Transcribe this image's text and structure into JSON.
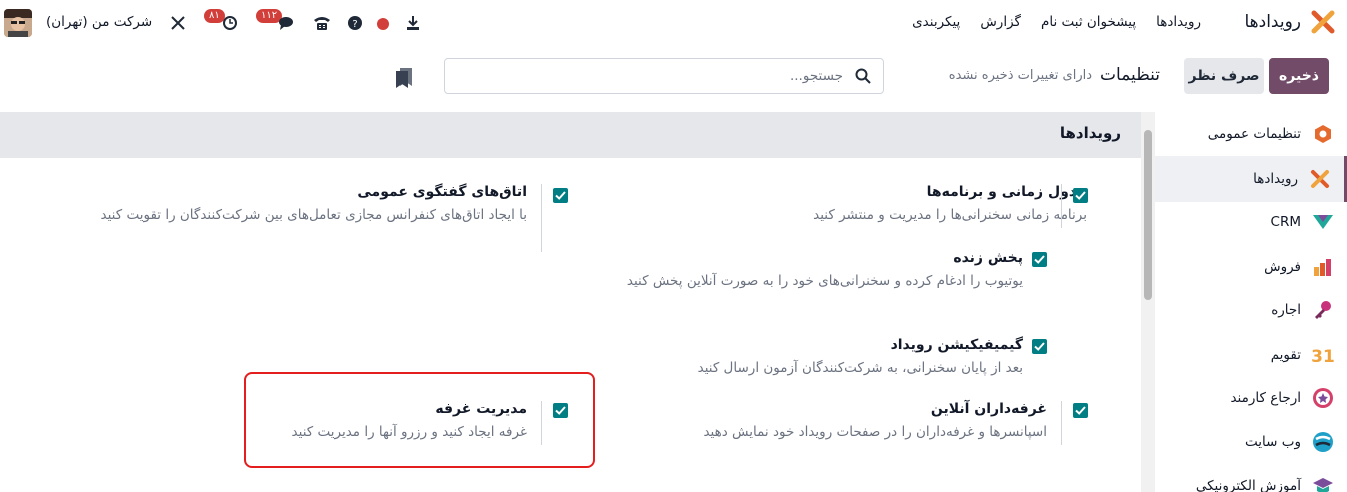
{
  "navbar": {
    "app_name": "رویدادها",
    "menu": [
      "رویدادها",
      "پیشخوان ثبت نام",
      "گزارش",
      "پیکربندی"
    ],
    "company": "شرکت من (تهران)",
    "activity_badge": "۸۱",
    "messages_badge": "۱۱۲"
  },
  "control_panel": {
    "save_label": "ذخیره",
    "discard_label": "صرف نظر",
    "title": "تنظیمات",
    "unsaved": "دارای تغییرات ذخیره نشده",
    "search_placeholder": "جستجو..."
  },
  "sidebar": {
    "items": [
      {
        "label": "تنظیمات عمومی",
        "icon": "settings-icon"
      },
      {
        "label": "رویدادها",
        "icon": "events-icon"
      },
      {
        "label": "CRM",
        "icon": "crm-icon"
      },
      {
        "label": "فروش",
        "icon": "sales-icon"
      },
      {
        "label": "اجاره",
        "icon": "rental-icon"
      },
      {
        "label": "تقویم",
        "icon": "calendar-icon"
      },
      {
        "label": "ارجاع کارمند",
        "icon": "referral-icon"
      },
      {
        "label": "وب سایت",
        "icon": "website-icon"
      },
      {
        "label": "آموزش الکترونیکی",
        "icon": "elearning-icon"
      }
    ]
  },
  "section": {
    "title": "رویدادها",
    "settings": [
      {
        "title": "جدول زمانی و برنامه‌ها",
        "desc": "برنامه زمانی سخنرانی‌ها را مدیریت و منتشر کنید",
        "checked": true
      },
      {
        "title": "پخش زنده",
        "desc": "یوتیوب را ادغام کرده و سخنرانی‌های خود را به صورت آنلاین پخش کنید",
        "checked": true
      },
      {
        "title": "گیمیفیکیشن رویداد",
        "desc": "بعد از پایان سخنرانی، به شرکت‌کنندگان آزمون ارسال کنید",
        "checked": true
      },
      {
        "title": "غرفه‌داران آنلاین",
        "desc": "اسپانسرها و غرفه‌داران را در صفحات رویداد خود نمایش دهید",
        "checked": true
      },
      {
        "title": "اتاق‌های گفتگوی عمومی",
        "desc": "با ایجاد اتاق‌های کنفرانس مجازی تعامل‌های بین شرکت‌کنندگان را تقویت کنید",
        "checked": true
      },
      {
        "title": "مدیریت غرفه",
        "desc": "غرفه ایجاد کنید و رزرو آنها را مدیریت کنید",
        "checked": true
      }
    ]
  }
}
